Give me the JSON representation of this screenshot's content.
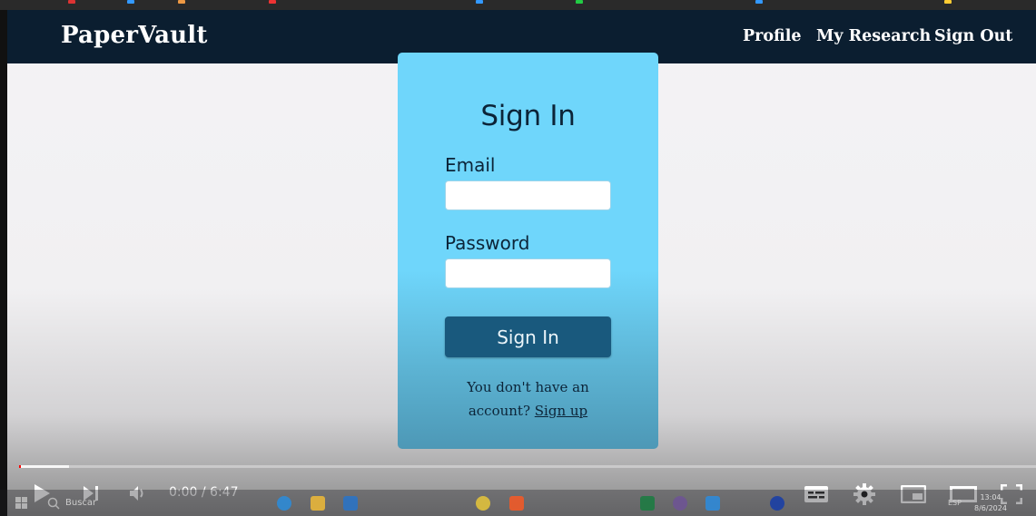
{
  "site": {
    "brand": "PaperVault",
    "nav": [
      {
        "label": "Profile"
      },
      {
        "label": "My Research"
      },
      {
        "label": "Sign Out"
      }
    ]
  },
  "signin": {
    "title": "Sign In",
    "email_label": "Email",
    "email_value": "",
    "password_label": "Password",
    "password_value": "",
    "submit_label": "Sign In",
    "signup_prompt": "You don't have an account?",
    "signup_link": "Sign up"
  },
  "player": {
    "time": "0:00 / 6:47",
    "progress_fraction": 0.0,
    "icons": [
      "play-icon",
      "next-icon",
      "volume-icon",
      "subtitles-icon",
      "settings-icon",
      "miniplayer-icon",
      "theater-mode-icon",
      "fullscreen-icon"
    ]
  },
  "taskbar": {
    "search_text": "Buscar",
    "time": "13:04",
    "date": "8/6/2024",
    "language": "ESP"
  },
  "colors": {
    "nav_bg": "#0b1e30",
    "card_bg": "#6fd6fb",
    "button_bg": "#19597d",
    "progress_red": "#ff0000"
  }
}
